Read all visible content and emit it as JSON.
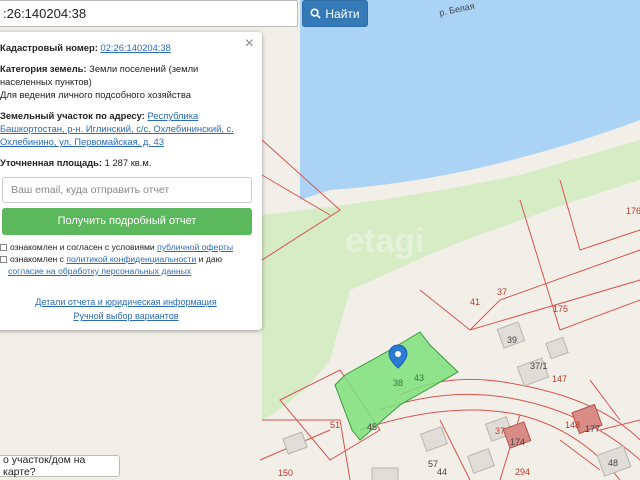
{
  "search": {
    "value": ":26:140204:38",
    "button_label": "Найти"
  },
  "popup": {
    "cadastral_label": "Кадастровый номер:",
    "cadastral_value": "02:26:140204:38",
    "category_label": "Категория земель:",
    "category_value_1": "Земли поселений (земли",
    "category_value_2": "населенных пунктов)",
    "purpose": "Для ведения личного подсобного хозяйства",
    "address_label": "Земельный участок по адресу:",
    "address_1": "Республика",
    "address_2": "Башкортостан, р-н. Иглинский, с/с. Охлебининский, с.",
    "address_3": "Охлебинино, ул. Первомайская, д. 43",
    "area_label": "Уточненная площадь:",
    "area_value": "1 287 кв.м.",
    "email_placeholder": "Ваш email, куда отправить отчет",
    "report_button": "Получить подробный отчет",
    "agree1_text": "ознакомлен и согласен с условиями",
    "agree1_link": "публичной оферты",
    "agree2_text": "ознакомлен с",
    "agree2_link": "политикой конфиденциальности",
    "agree2_tail": "и даю",
    "agree3_link": "согласие на обработку персональных данных",
    "details_link": "Детали отчета и юридическая информация",
    "manual_link": "Ручной выбор вариантов"
  },
  "map": {
    "river_label": "р. Белая",
    "watermark": "etagi",
    "parcel_numbers": {
      "n38": "38",
      "n43": "43",
      "n41": "41",
      "n37": "37",
      "n175": "175",
      "n176": "176",
      "n39": "39",
      "n37_1": "37/1",
      "n147": "147",
      "n51": "51",
      "n45": "45",
      "n37b": "37",
      "n148": "148",
      "n57": "57",
      "n44": "44",
      "n294": "294",
      "n150": "150",
      "n48": "48",
      "n174": "174",
      "n177": "177"
    }
  },
  "bottom_button": "о участок/дом на карте?",
  "colors": {
    "accent": "#337ab7",
    "green": "#5cb85c",
    "water": "#aad3f5",
    "parcel_line": "#d9534f"
  }
}
